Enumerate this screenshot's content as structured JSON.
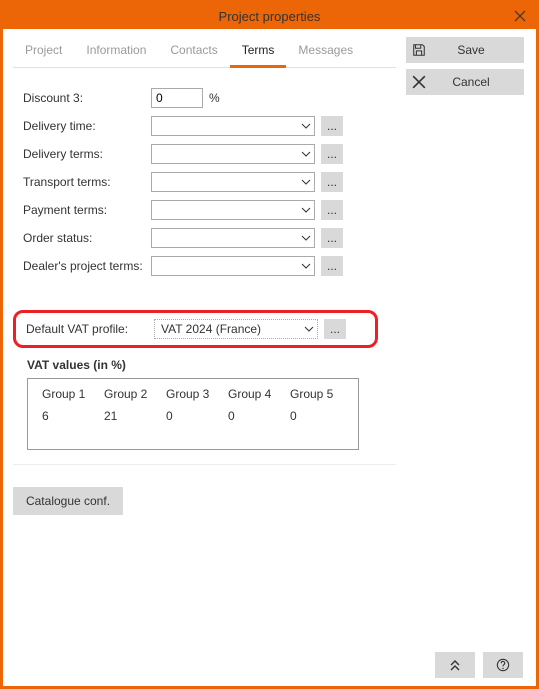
{
  "window": {
    "title": "Project properties"
  },
  "tabs": [
    {
      "label": "Project",
      "active": false
    },
    {
      "label": "Information",
      "active": false
    },
    {
      "label": "Contacts",
      "active": false
    },
    {
      "label": "Terms",
      "active": true
    },
    {
      "label": "Messages",
      "active": false
    }
  ],
  "actions": {
    "save": "Save",
    "cancel": "Cancel"
  },
  "form": {
    "discount3": {
      "label": "Discount 3:",
      "value": "0",
      "suffix": "%"
    },
    "delivery_time": {
      "label": "Delivery time:",
      "value": ""
    },
    "delivery_terms": {
      "label": "Delivery terms:",
      "value": ""
    },
    "transport_terms": {
      "label": "Transport terms:",
      "value": ""
    },
    "payment_terms": {
      "label": "Payment terms:",
      "value": ""
    },
    "order_status": {
      "label": "Order status:",
      "value": ""
    },
    "dealer_terms": {
      "label": "Dealer's project terms:",
      "value": ""
    }
  },
  "vat": {
    "label": "Default VAT profile:",
    "value": "VAT 2024 (France)",
    "table_heading": "VAT values (in %)",
    "groups": [
      "Group 1",
      "Group 2",
      "Group 3",
      "Group 4",
      "Group 5"
    ],
    "values": [
      "6",
      "21",
      "0",
      "0",
      "0"
    ]
  },
  "catalogue_btn": "Catalogue conf.",
  "ellipsis": "..."
}
